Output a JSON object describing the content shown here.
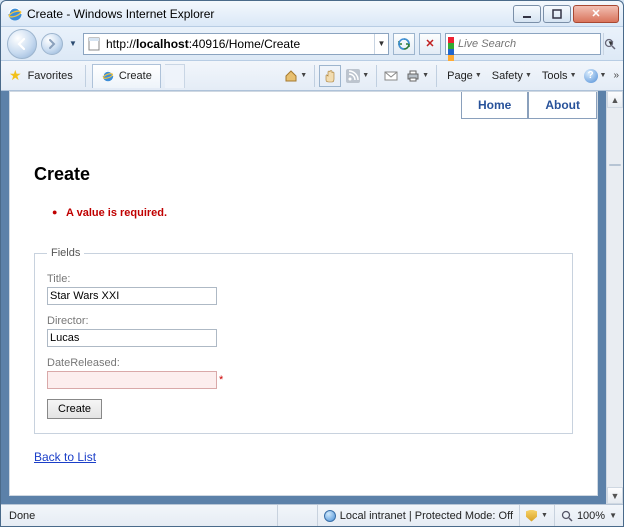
{
  "window": {
    "title": "Create - Windows Internet Explorer"
  },
  "nav": {
    "url_prefix": "http://",
    "url_host": "localhost",
    "url_suffix": ":40916/Home/Create",
    "search_placeholder": "Live Search"
  },
  "favrow": {
    "favorites_label": "Favorites",
    "tab_title": "Create"
  },
  "ietoolbar": {
    "page_label": "Page",
    "safety_label": "Safety",
    "tools_label": "Tools"
  },
  "navtabs": {
    "home": "Home",
    "about": "About"
  },
  "page": {
    "heading": "Create",
    "error_message": "A value is required.",
    "legend": "Fields",
    "title_label": "Title:",
    "title_value": "Star Wars XXI",
    "director_label": "Director:",
    "director_value": "Lucas",
    "date_label": "DateReleased:",
    "date_value": "",
    "create_button": "Create",
    "back_link": "Back to List"
  },
  "statusbar": {
    "done": "Done",
    "zone": "Local intranet | Protected Mode: Off",
    "zoom": "100%"
  }
}
